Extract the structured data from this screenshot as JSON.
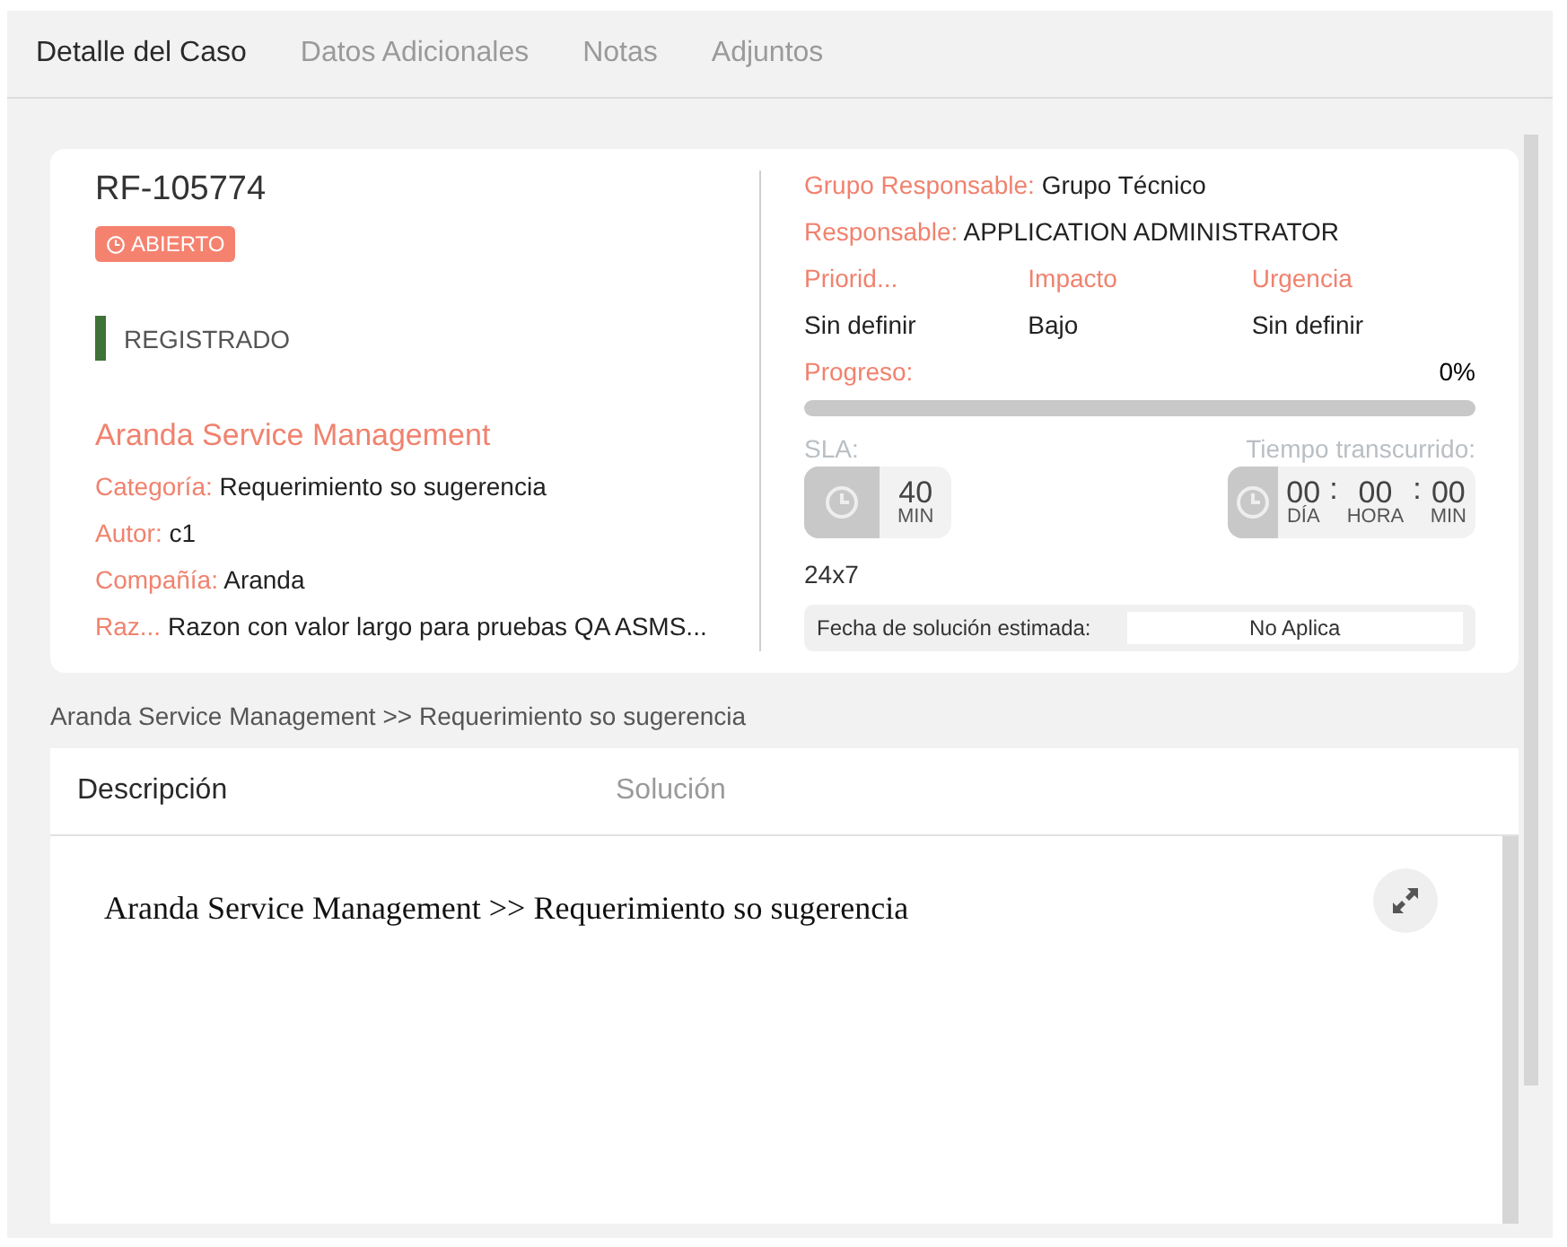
{
  "tabs": [
    {
      "label": "Detalle del Caso",
      "selected": true
    },
    {
      "label": "Datos Adicionales",
      "selected": false
    },
    {
      "label": "Notas",
      "selected": false
    },
    {
      "label": "Adjuntos",
      "selected": false
    }
  ],
  "case": {
    "id": "RF-105774",
    "status": "ABIERTO",
    "stage": {
      "label": "REGISTRADO",
      "color": "#3f7236"
    },
    "service": "Aranda Service Management",
    "fields": [
      {
        "label": "Categoría:",
        "value": "Requerimiento so sugerencia"
      },
      {
        "label": "Autor:",
        "value": "c1"
      },
      {
        "label": "Compañía:",
        "value": "Aranda"
      },
      {
        "label": "Raz...",
        "value": "Razon con valor largo para pruebas QA ASMS..."
      }
    ]
  },
  "assignment": [
    {
      "label": "Grupo Responsable:",
      "value": "Grupo Técnico"
    },
    {
      "label": "Responsable:",
      "value": "APPLICATION ADMINISTRATOR"
    }
  ],
  "ratings": [
    {
      "label": "Priorid...",
      "value": "Sin definir"
    },
    {
      "label": "Impacto",
      "value": "Bajo"
    },
    {
      "label": "Urgencia",
      "value": "Sin definir"
    }
  ],
  "progress": {
    "label": "Progreso:",
    "reading": "0%",
    "level": 0
  },
  "sla": {
    "label": "SLA:",
    "value": "40",
    "unit": "MIN",
    "calendar": "24x7"
  },
  "elapsed": {
    "label": "Tiempo transcurrido:",
    "separator": ":",
    "parts": [
      {
        "value": "00",
        "unit": "DÍA"
      },
      {
        "value": "00",
        "unit": "HORA"
      },
      {
        "value": "00",
        "unit": "MIN"
      }
    ]
  },
  "estimate": {
    "label": "Fecha de solución estimada:",
    "value": "No Aplica"
  },
  "breadcrumb": "Aranda Service Management >> Requerimiento so sugerencia",
  "detail_tabs": [
    {
      "label": "Descripción",
      "selected": true
    },
    {
      "label": "Solución",
      "selected": false
    }
  ],
  "description": "Aranda Service Management >> Requerimiento so sugerencia"
}
